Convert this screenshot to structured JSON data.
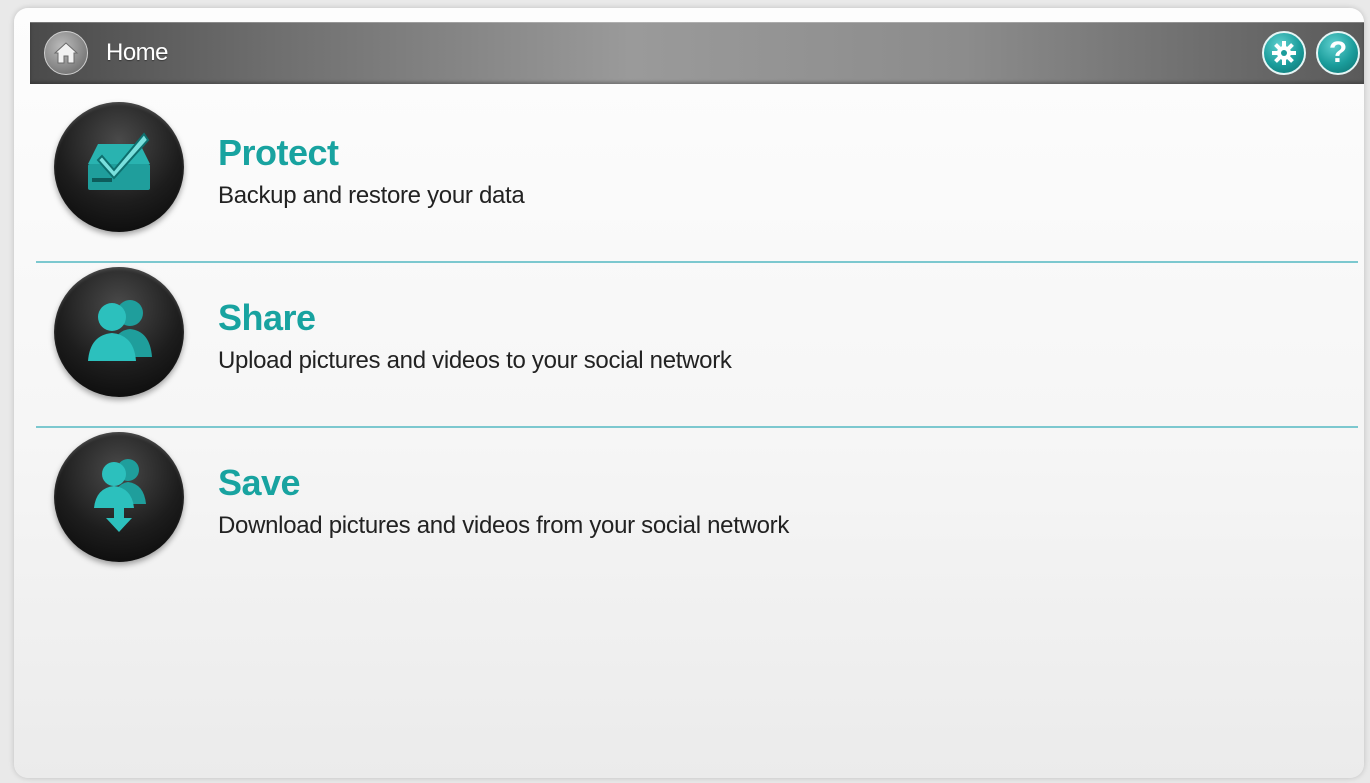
{
  "header": {
    "title": "Home",
    "settings_label": "Settings",
    "help_label": "?"
  },
  "menu": [
    {
      "title": "Protect",
      "description": "Backup and restore your data",
      "icon": "protect-drive-check-icon"
    },
    {
      "title": "Share",
      "description": "Upload pictures and videos to your social network",
      "icon": "share-people-icon"
    },
    {
      "title": "Save",
      "description": "Download pictures and videos from your social network",
      "icon": "save-people-download-icon"
    }
  ],
  "colors": {
    "accent": "#18a3a0",
    "divider": "#7cc8cf",
    "header_dark": "#4a4a4a"
  }
}
